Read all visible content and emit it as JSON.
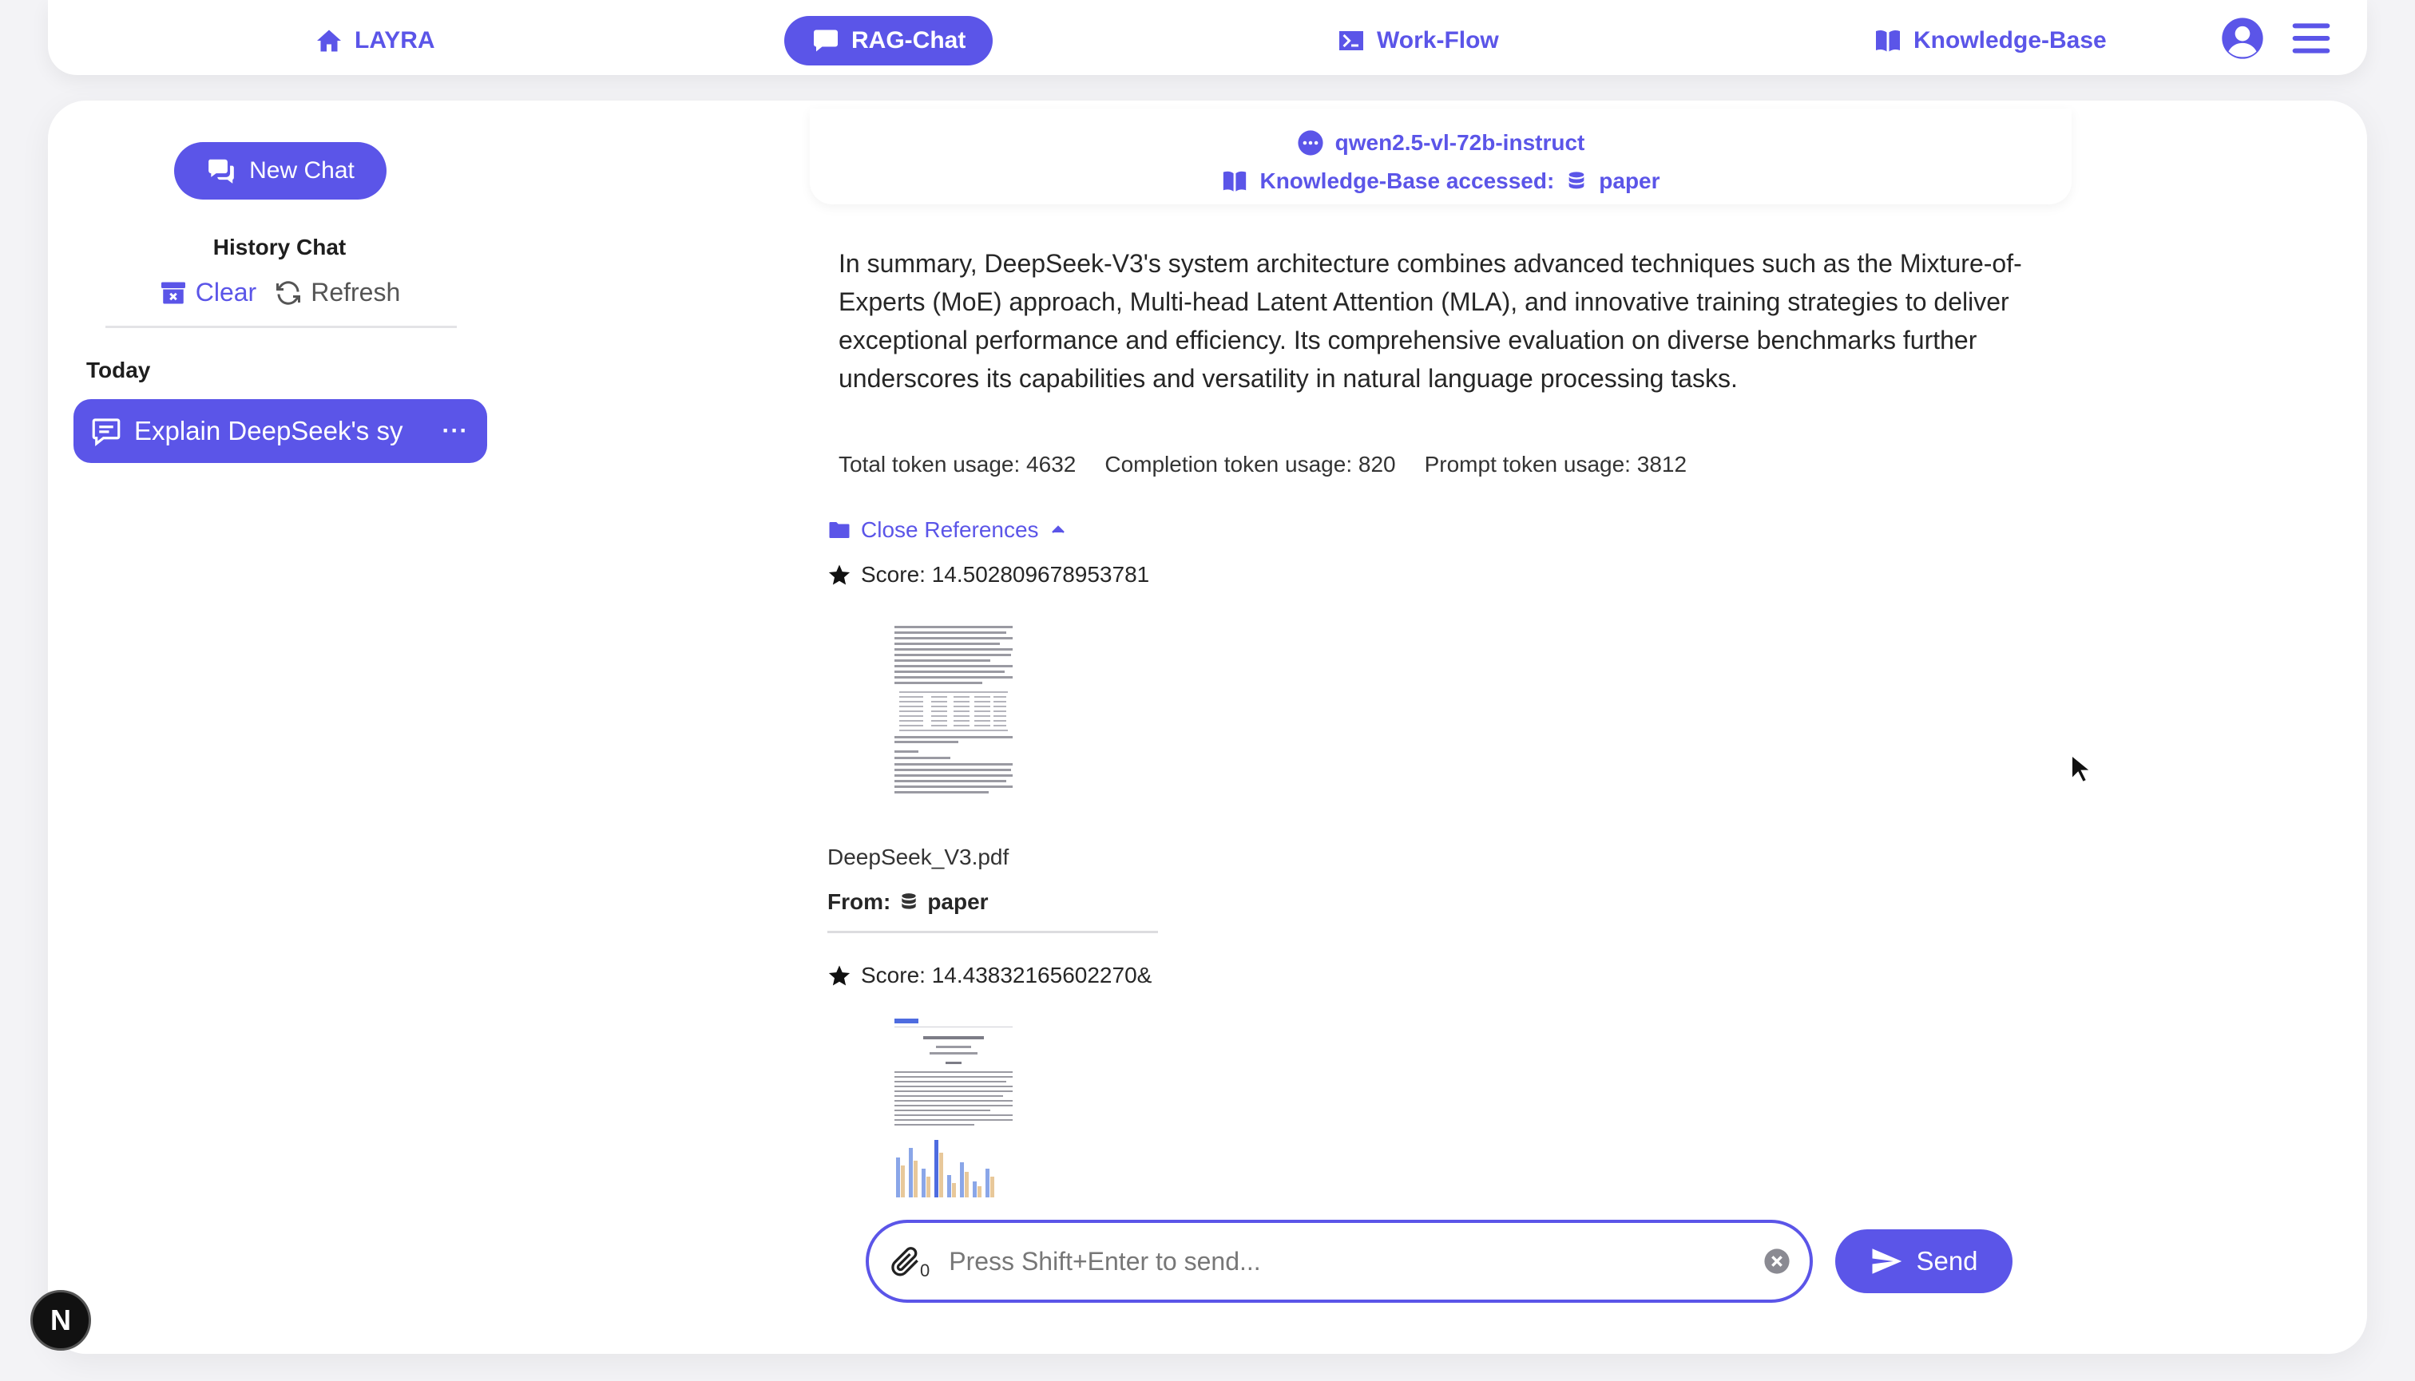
{
  "nav": {
    "home_label": "LAYRA",
    "rag_chat_label": "RAG-Chat",
    "workflow_label": "Work-Flow",
    "knowledge_base_label": "Knowledge-Base",
    "active": "RAG-Chat"
  },
  "sidebar": {
    "new_chat_label": "New Chat",
    "history_title": "History Chat",
    "clear_label": "Clear",
    "refresh_label": "Refresh",
    "groups": [
      {
        "label": "Today",
        "items": [
          {
            "title": "Explain DeepSeek's sy",
            "more": "···",
            "selected": true
          }
        ]
      }
    ]
  },
  "chat": {
    "model_name": "qwen2.5-vl-72b-instruct",
    "kb_label": "Knowledge-Base accessed:",
    "kb_name": "paper",
    "answer": "In summary, DeepSeek-V3's system architecture combines advanced techniques such as the Mixture-of-Experts (MoE) approach, Multi-head Latent Attention (MLA), and innovative training strategies to deliver exceptional performance and efficiency. Its comprehensive evaluation on diverse benchmarks further underscores its capabilities and versatility in natural language processing tasks.",
    "tokens": {
      "total": "Total token usage: 4632",
      "completion": "Completion token usage: 820",
      "prompt": "Prompt token usage: 3812"
    },
    "close_refs_label": "Close References",
    "references": [
      {
        "score": "Score: 14.502809678953781",
        "file": "DeepSeek_V3.pdf",
        "from_label": "From:",
        "from_kb": "paper"
      },
      {
        "score": "Score: 14.43832165602270&"
      }
    ]
  },
  "input": {
    "placeholder": "Press Shift+Enter to send...",
    "attachment_count": "0",
    "send_label": "Send"
  },
  "badge": {
    "letter": "N"
  },
  "colors": {
    "accent": "#5b55e8",
    "background": "#f3f3f6"
  }
}
